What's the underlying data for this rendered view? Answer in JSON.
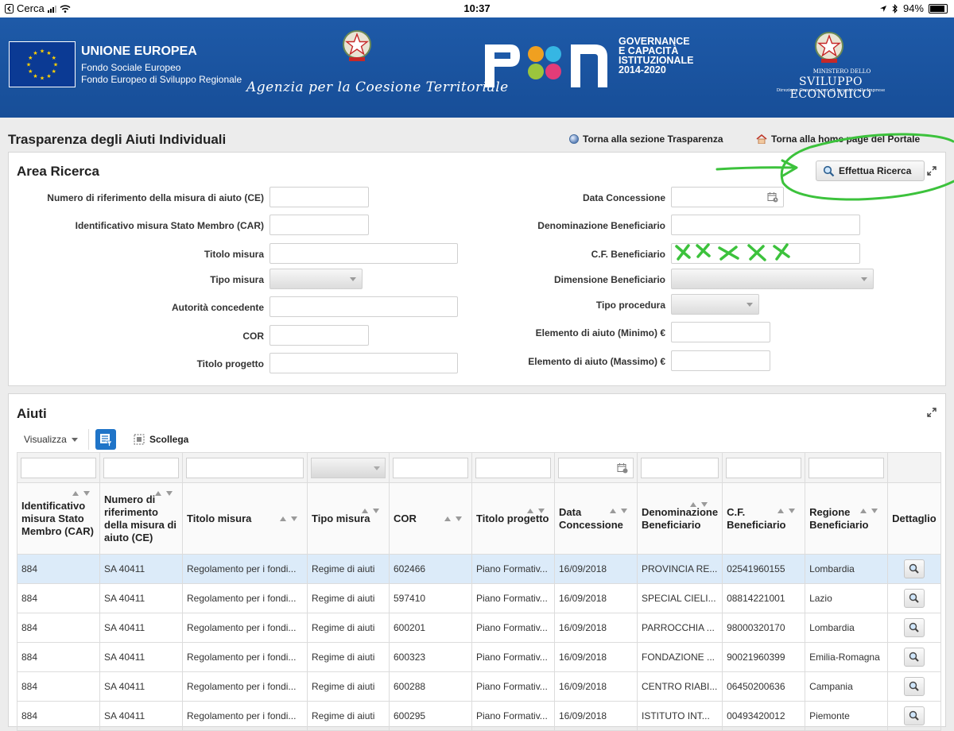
{
  "status_bar": {
    "back_label": "Cerca",
    "time": "10:37",
    "battery": "94%",
    "battery_level": 0.94
  },
  "banner": {
    "eu_title": "UNIONE EUROPEA",
    "eu_line1": "Fondo Sociale Europeo",
    "eu_line2": "Fondo Europeo di Sviluppo Regionale",
    "agency": "Agenzia per la Coesione Territoriale",
    "pon_line1": "GOVERNANCE",
    "pon_line2": "E CAPACITÀ",
    "pon_line3": "ISTITUZIONALE",
    "pon_line4": "2014-2020",
    "mise_line1": "MINISTERO DELLO",
    "mise_line2": "SVILUPPO ECONOMICO",
    "mise_line3": "Direzione Generale per gli Incentivi alle Imprese"
  },
  "header": {
    "title": "Trasparenza degli Aiuti Individuali",
    "link_transparency": "Torna alla sezione Trasparenza",
    "link_home": "Torna alla home page del Portale"
  },
  "search": {
    "title": "Area Ricerca",
    "button": "Effettua Ricerca",
    "left_fields": [
      "Numero di riferimento della misura di aiuto (CE)",
      "Identificativo misura Stato Membro (CAR)",
      "Titolo misura",
      "Tipo misura",
      "Autorità concedente",
      "COR",
      "Titolo progetto"
    ],
    "right_fields": [
      "Data Concessione",
      "Denominazione Beneficiario",
      "C.F. Beneficiario",
      "Dimensione Beneficiario",
      "Tipo procedura",
      "Elemento di aiuto (Minimo) €",
      "Elemento di aiuto (Massimo) €"
    ]
  },
  "results": {
    "title": "Aiuti",
    "view_label": "Visualizza",
    "detach_label": "Scollega",
    "columns": [
      "Identificativo misura Stato Membro (CAR)",
      "Numero di riferimento della misura di aiuto (CE)",
      "Titolo misura",
      "Tipo misura",
      "COR",
      "Titolo progetto",
      "Data Concessione",
      "Denominazione Beneficiario",
      "C.F. Beneficiario",
      "Regione Beneficiario",
      "Dettaglio"
    ],
    "rows": [
      [
        "884",
        "SA 40411",
        "Regolamento per i fondi...",
        "Regime di aiuti",
        "602466",
        "Piano Formativ...",
        "16/09/2018",
        "PROVINCIA RE...",
        "02541960155",
        "Lombardia"
      ],
      [
        "884",
        "SA 40411",
        "Regolamento per i fondi...",
        "Regime di aiuti",
        "597410",
        "Piano Formativ...",
        "16/09/2018",
        "SPECIAL CIELI...",
        "08814221001",
        "Lazio"
      ],
      [
        "884",
        "SA 40411",
        "Regolamento per i fondi...",
        "Regime di aiuti",
        "600201",
        "Piano Formativ...",
        "16/09/2018",
        "PARROCCHIA ...",
        "98000320170",
        "Lombardia"
      ],
      [
        "884",
        "SA 40411",
        "Regolamento per i fondi...",
        "Regime di aiuti",
        "600323",
        "Piano Formativ...",
        "16/09/2018",
        "FONDAZIONE ...",
        "90021960399",
        "Emilia-Romagna"
      ],
      [
        "884",
        "SA 40411",
        "Regolamento per i fondi...",
        "Regime di aiuti",
        "600288",
        "Piano Formativ...",
        "16/09/2018",
        "CENTRO RIABI...",
        "06450200636",
        "Campania"
      ],
      [
        "884",
        "SA 40411",
        "Regolamento per i fondi...",
        "Regime di aiuti",
        "600295",
        "Piano Formativ...",
        "16/09/2018",
        "ISTITUTO INT...",
        "00493420012",
        "Piemonte"
      ]
    ]
  },
  "colors": {
    "banner": "#1e5aa8",
    "annotation": "#3cc23c",
    "selected_row": "#dcebf9",
    "filter_button": "#1f74c8"
  }
}
